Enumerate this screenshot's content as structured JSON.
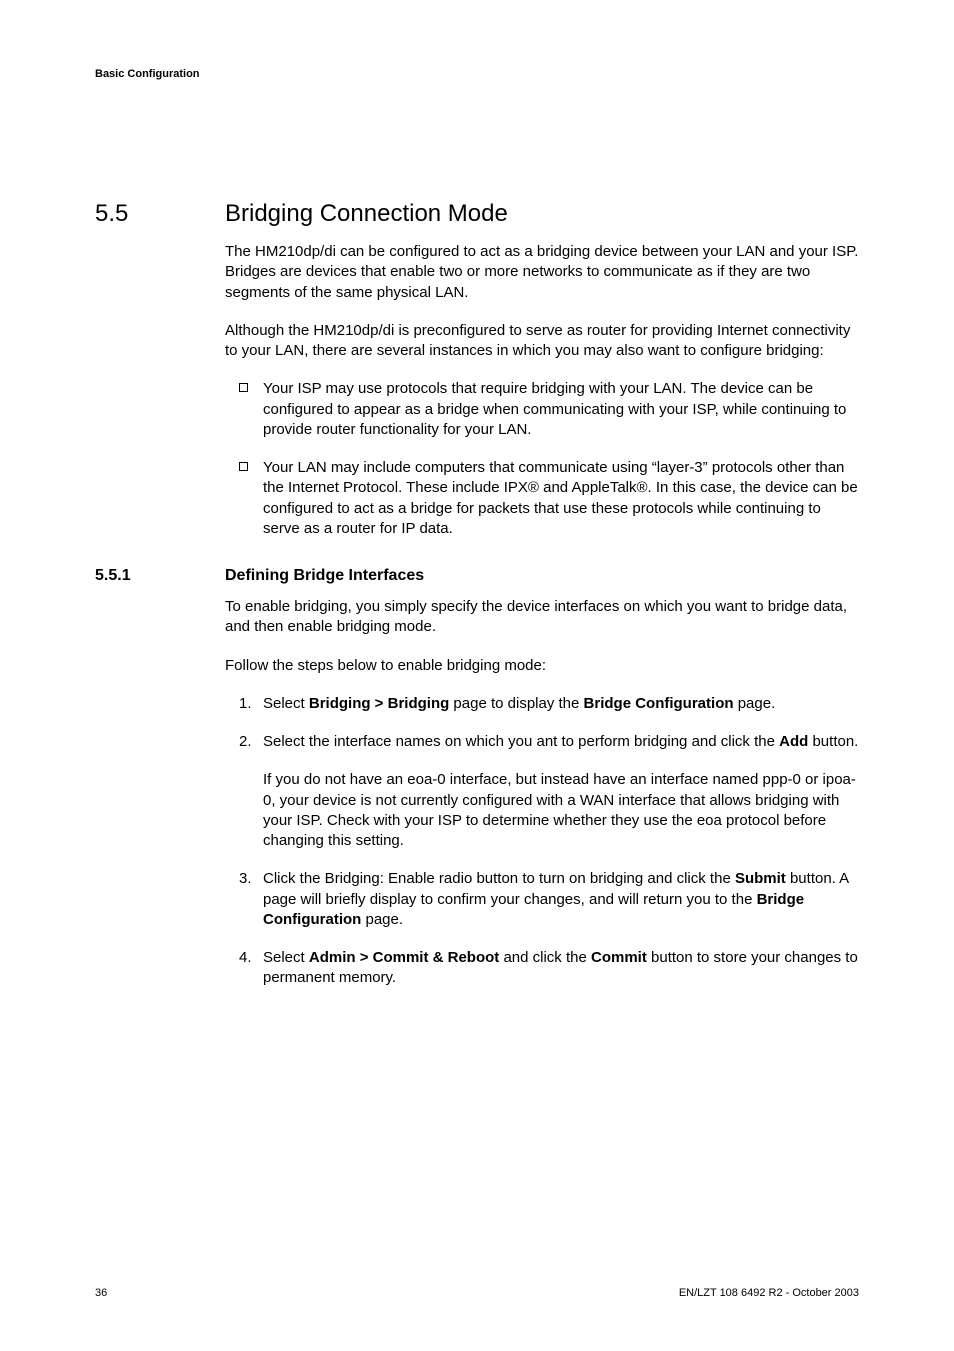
{
  "header": {
    "running": "Basic Configuration"
  },
  "section": {
    "number": "5.5",
    "title": "Bridging Connection Mode",
    "p1": "The HM210dp/di can be configured to act as a bridging device between your LAN and your ISP. Bridges are devices that enable two or more networks to communicate as if they are two segments of the same physical LAN.",
    "p2": "Although the HM210dp/di is preconfigured to serve as router for providing Internet connectivity to your LAN, there are several instances in which you may also want to configure bridging:",
    "bullets": [
      "Your ISP may use protocols that require bridging with your LAN. The device can be configured to appear as a bridge when communicating with your ISP, while continuing to provide router functionality for your LAN.",
      "Your LAN may include computers that communicate using “layer-3” protocols other than the Internet Protocol. These include IPX® and AppleTalk®. In this case, the device can be configured to act as a bridge for packets that use these protocols while continuing to serve as a router for IP data."
    ]
  },
  "subsection": {
    "number": "5.5.1",
    "title": "Defining Bridge Interfaces",
    "p1": "To enable bridging, you simply specify the device interfaces on which you want to bridge data, and then enable bridging mode.",
    "p2": "Follow the steps below to enable bridging mode:",
    "steps": {
      "s1a": "Select ",
      "s1b": "Bridging > Bridging",
      "s1c": " page to display the ",
      "s1d": "Bridge Configuration",
      "s1e": " page.",
      "s2a": "Select the interface names on which you ant to perform bridging and click the ",
      "s2b": "Add",
      "s2c": " button.",
      "s2_note": "If you do not have an eoa-0 interface, but instead have an interface named ppp-0 or ipoa-0, your device is not currently configured with a WAN interface that allows bridging with your ISP. Check with your ISP to determine whether they use the eoa protocol before changing this setting.",
      "s3a": "Click the Bridging: Enable radio button to turn on bridging and click the ",
      "s3b": "Submit",
      "s3c": " button. A page will briefly display to confirm your changes, and will return you to the ",
      "s3d": "Bridge Configuration",
      "s3e": " page.",
      "s4a": "Select ",
      "s4b": "Admin > Commit & Reboot",
      "s4c": " and click the ",
      "s4d": "Commit",
      "s4e": " button to store your changes to permanent memory."
    }
  },
  "footer": {
    "page": "36",
    "docid": "EN/LZT 108 6492 R2  - October 2003"
  }
}
